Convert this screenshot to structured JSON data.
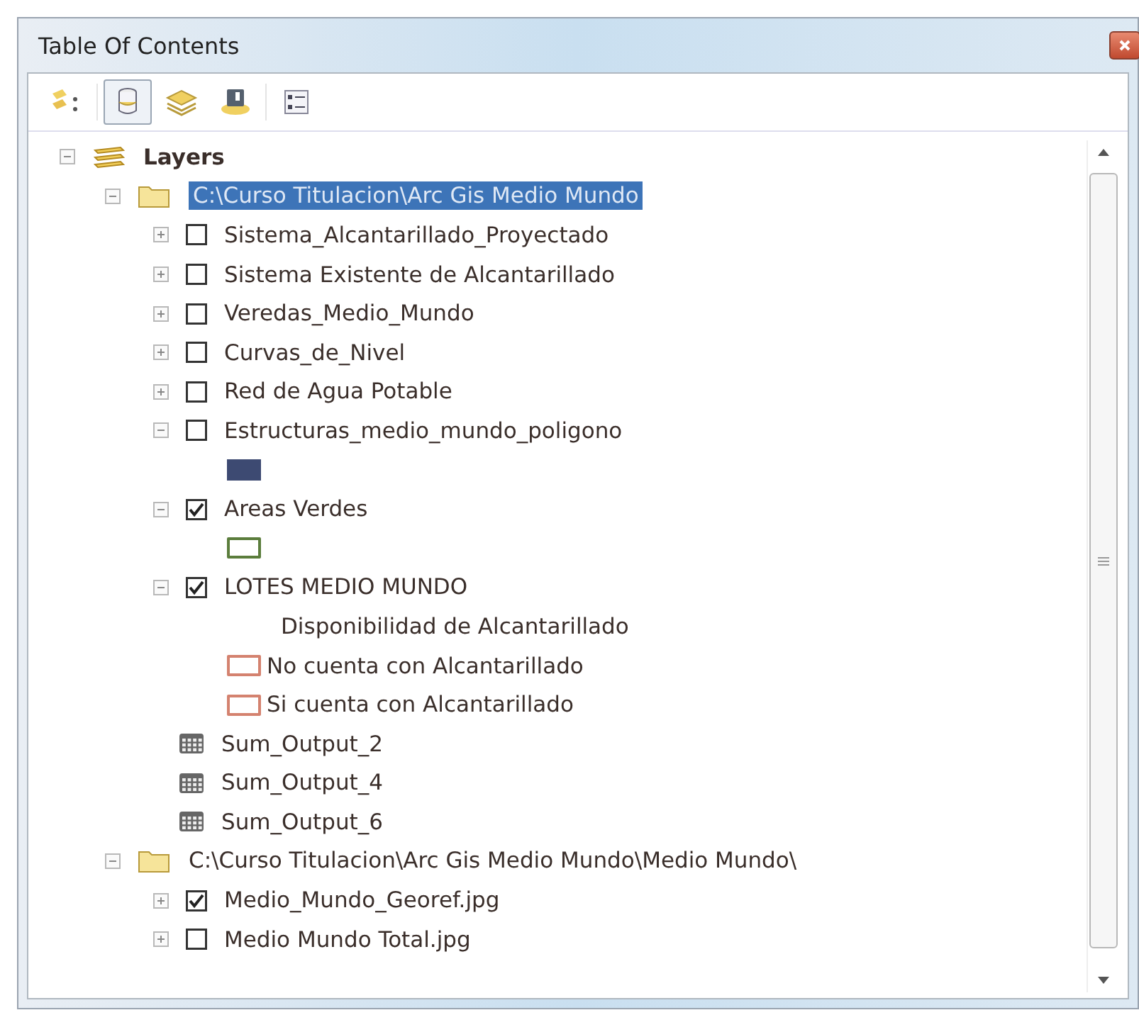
{
  "window": {
    "title": "Table Of Contents"
  },
  "toolbar": [
    {
      "kind": "drawing-order",
      "selected": false
    },
    {
      "kind": "source",
      "selected": true
    },
    {
      "kind": "visibility",
      "selected": false
    },
    {
      "kind": "selection",
      "selected": false
    },
    {
      "kind": "options",
      "selected": false
    }
  ],
  "tree": [
    {
      "kind": "group",
      "label": "Layers",
      "expanded": true,
      "children": [
        {
          "kind": "folder",
          "label": "C:\\Curso Titulacion\\Arc Gis Medio Mundo",
          "selected": true,
          "expanded": true,
          "children": [
            {
              "kind": "layer",
              "label": "Sistema_Alcantarillado_Proyectado",
              "checked": false,
              "expanded": false
            },
            {
              "kind": "layer",
              "label": "Sistema Existente de Alcantarillado",
              "checked": false,
              "expanded": false
            },
            {
              "kind": "layer",
              "label": "Veredas_Medio_Mundo",
              "checked": false,
              "expanded": false
            },
            {
              "kind": "layer",
              "label": "Curvas_de_Nivel",
              "checked": false,
              "expanded": false
            },
            {
              "kind": "layer",
              "label": "Red de Agua Potable",
              "checked": false,
              "expanded": false
            },
            {
              "kind": "layer",
              "label": "Estructuras_medio_mundo_poligono",
              "checked": false,
              "expanded": true,
              "legend": [
                {
                  "kind": "fill",
                  "color": "#3d4a72"
                }
              ]
            },
            {
              "kind": "layer",
              "label": "Areas Verdes",
              "checked": true,
              "expanded": true,
              "legend": [
                {
                  "kind": "outline",
                  "color": "#5b7d3c"
                }
              ]
            },
            {
              "kind": "layer",
              "label": "LOTES MEDIO MUNDO",
              "checked": true,
              "expanded": true,
              "legend": [
                {
                  "kind": "heading",
                  "label": "Disponibilidad de Alcantarillado"
                },
                {
                  "kind": "outline",
                  "color": "#d4826f",
                  "label": "No cuenta con Alcantarillado"
                },
                {
                  "kind": "outline",
                  "color": "#d4826f",
                  "label": "Si cuenta con Alcantarillado"
                }
              ]
            },
            {
              "kind": "table",
              "label": "Sum_Output_2"
            },
            {
              "kind": "table",
              "label": "Sum_Output_4"
            },
            {
              "kind": "table",
              "label": "Sum_Output_6"
            }
          ]
        },
        {
          "kind": "folder",
          "label": "C:\\Curso Titulacion\\Arc Gis Medio Mundo\\Medio Mundo\\",
          "selected": false,
          "expanded": true,
          "children": [
            {
              "kind": "layer",
              "label": "Medio_Mundo_Georef.jpg",
              "checked": true,
              "expanded": false
            },
            {
              "kind": "layer",
              "label": "Medio Mundo Total.jpg",
              "checked": false,
              "expanded": false
            }
          ]
        }
      ]
    }
  ]
}
